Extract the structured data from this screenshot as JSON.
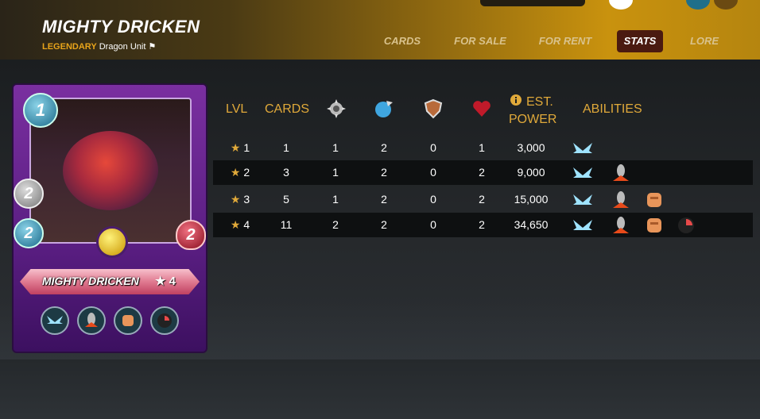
{
  "header": {
    "title": "MIGHTY DRICKEN",
    "rarity": "LEGENDARY",
    "unit_type": "Dragon Unit",
    "unit_glyph": "⚑"
  },
  "nav": {
    "tabs": [
      {
        "label": "CARDS",
        "active": false
      },
      {
        "label": "FOR SALE",
        "active": false
      },
      {
        "label": "FOR RENT",
        "active": false
      },
      {
        "label": "STATS",
        "active": true
      },
      {
        "label": "LORE",
        "active": false
      }
    ]
  },
  "card": {
    "name": "MIGHTY DRICKEN",
    "level": "★ 4",
    "mana": "1",
    "attack": "2",
    "speed": "2",
    "health": "2",
    "ability_icons": [
      "wings-icon",
      "shield-crack-icon",
      "fist-icon",
      "dark-magic-icon"
    ]
  },
  "stats_table": {
    "headers": {
      "lvl": "LVL",
      "cards": "CARDS",
      "attack_icon": "melee-attack-icon",
      "speed_icon": "speed-icon",
      "armor_icon": "armor-icon",
      "health_icon": "health-icon",
      "info_icon": "info-icon",
      "power_line1": "EST.",
      "power_line2": "POWER",
      "abilities": "ABILITIES"
    },
    "rows": [
      {
        "lvl": "1",
        "cards": "1",
        "attack": "1",
        "speed": "2",
        "armor": "0",
        "health": "1",
        "power": "3,000",
        "abilities": [
          "flying-icon"
        ]
      },
      {
        "lvl": "2",
        "cards": "3",
        "attack": "1",
        "speed": "2",
        "armor": "0",
        "health": "2",
        "power": "9,000",
        "abilities": [
          "flying-icon",
          "shatter-icon"
        ]
      },
      {
        "lvl": "3",
        "cards": "5",
        "attack": "1",
        "speed": "2",
        "armor": "0",
        "health": "2",
        "power": "15,000",
        "abilities": [
          "flying-icon",
          "shatter-icon",
          "punch-icon"
        ]
      },
      {
        "lvl": "4",
        "cards": "11",
        "attack": "2",
        "speed": "2",
        "armor": "0",
        "health": "2",
        "power": "34,650",
        "abilities": [
          "flying-icon",
          "shatter-icon",
          "punch-icon",
          "dark-icon"
        ]
      }
    ],
    "star_glyph": "★"
  },
  "colors": {
    "accent": "#e0a93a",
    "active_tab": "#4a1a10",
    "row_dark": "#0e1011"
  }
}
